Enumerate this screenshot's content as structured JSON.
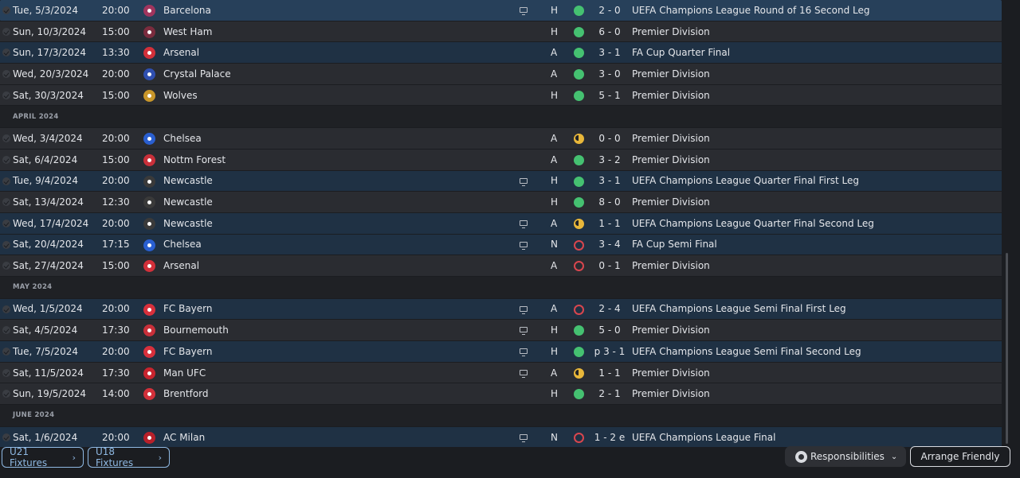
{
  "rows": [
    {
      "type": "match",
      "cls": "comp sel",
      "date": "Tue, 5/3/2024",
      "time": "20:00",
      "opponent": "Barcelona",
      "badge_color": "#a1355e",
      "badge_icon": "crest-icon",
      "tv": true,
      "venue": "H",
      "result": "w",
      "score": "2 - 0",
      "competition": "UEFA Champions League Round of 16 Second Leg"
    },
    {
      "type": "match",
      "cls": "dom",
      "date": "Sun, 10/3/2024",
      "time": "15:00",
      "opponent": "West Ham",
      "badge_color": "#7b2c3e",
      "badge_icon": "crest-icon",
      "tv": false,
      "venue": "H",
      "result": "w",
      "score": "6 - 0",
      "competition": "Premier Division"
    },
    {
      "type": "match",
      "cls": "comp",
      "date": "Sun, 17/3/2024",
      "time": "13:30",
      "opponent": "Arsenal",
      "badge_color": "#d2303a",
      "badge_icon": "crest-icon",
      "tv": false,
      "venue": "A",
      "result": "w",
      "score": "3 - 1",
      "competition": "FA Cup Quarter Final"
    },
    {
      "type": "match",
      "cls": "dom",
      "date": "Wed, 20/3/2024",
      "time": "20:00",
      "opponent": "Crystal Palace",
      "badge_color": "#2f4fb0",
      "badge_icon": "crest-icon",
      "tv": false,
      "venue": "A",
      "result": "w",
      "score": "3 - 0",
      "competition": "Premier Division"
    },
    {
      "type": "match",
      "cls": "dom",
      "date": "Sat, 30/3/2024",
      "time": "15:00",
      "opponent": "Wolves",
      "badge_color": "#c8962a",
      "badge_icon": "crest-icon",
      "tv": false,
      "venue": "H",
      "result": "w",
      "score": "5 - 1",
      "competition": "Premier Division"
    },
    {
      "type": "header",
      "label": "APRIL 2024"
    },
    {
      "type": "match",
      "cls": "dom",
      "date": "Wed, 3/4/2024",
      "time": "20:00",
      "opponent": "Chelsea",
      "badge_color": "#2a5fd0",
      "badge_icon": "crest-icon",
      "tv": false,
      "venue": "A",
      "result": "d",
      "score": "0 - 0",
      "competition": "Premier Division"
    },
    {
      "type": "match",
      "cls": "dom",
      "date": "Sat, 6/4/2024",
      "time": "15:00",
      "opponent": "Nottm Forest",
      "badge_color": "#c9303a",
      "badge_icon": "crest-icon",
      "tv": false,
      "venue": "A",
      "result": "w",
      "score": "3 - 2",
      "competition": "Premier Division"
    },
    {
      "type": "match",
      "cls": "comp",
      "date": "Tue, 9/4/2024",
      "time": "20:00",
      "opponent": "Newcastle",
      "badge_color": "#3a3a3a",
      "badge_icon": "crest-icon",
      "tv": true,
      "venue": "H",
      "result": "w",
      "score": "3 - 1",
      "competition": "UEFA Champions League Quarter Final First Leg"
    },
    {
      "type": "match",
      "cls": "dom",
      "date": "Sat, 13/4/2024",
      "time": "12:30",
      "opponent": "Newcastle",
      "badge_color": "#3a3a3a",
      "badge_icon": "crest-icon",
      "tv": false,
      "venue": "H",
      "result": "w",
      "score": "8 - 0",
      "competition": "Premier Division"
    },
    {
      "type": "match",
      "cls": "comp",
      "date": "Wed, 17/4/2024",
      "time": "20:00",
      "opponent": "Newcastle",
      "badge_color": "#3a3a3a",
      "badge_icon": "crest-icon",
      "tv": true,
      "venue": "A",
      "result": "d",
      "score": "1 - 1",
      "competition": "UEFA Champions League Quarter Final Second Leg"
    },
    {
      "type": "match",
      "cls": "comp",
      "date": "Sat, 20/4/2024",
      "time": "17:15",
      "opponent": "Chelsea",
      "badge_color": "#2a5fd0",
      "badge_icon": "crest-icon",
      "tv": true,
      "venue": "N",
      "result": "l",
      "score": "3 - 4",
      "competition": "FA Cup Semi Final"
    },
    {
      "type": "match",
      "cls": "dom",
      "date": "Sat, 27/4/2024",
      "time": "15:00",
      "opponent": "Arsenal",
      "badge_color": "#d2303a",
      "badge_icon": "crest-icon",
      "tv": false,
      "venue": "A",
      "result": "l",
      "score": "0 - 1",
      "competition": "Premier Division"
    },
    {
      "type": "header",
      "label": "MAY 2024"
    },
    {
      "type": "match",
      "cls": "comp",
      "date": "Wed, 1/5/2024",
      "time": "20:00",
      "opponent": "FC Bayern",
      "badge_color": "#d8303c",
      "badge_icon": "crest-icon",
      "tv": true,
      "venue": "A",
      "result": "l",
      "score": "2 - 4",
      "competition": "UEFA Champions League Semi Final First Leg"
    },
    {
      "type": "match",
      "cls": "dom",
      "date": "Sat, 4/5/2024",
      "time": "17:30",
      "opponent": "Bournemouth",
      "badge_color": "#c9303a",
      "badge_icon": "crest-icon",
      "tv": true,
      "venue": "H",
      "result": "w",
      "score": "5 - 0",
      "competition": "Premier Division"
    },
    {
      "type": "match",
      "cls": "comp",
      "date": "Tue, 7/5/2024",
      "time": "20:00",
      "opponent": "FC Bayern",
      "badge_color": "#d8303c",
      "badge_icon": "crest-icon",
      "tv": true,
      "venue": "H",
      "result": "w",
      "score": "p 3 - 1",
      "competition": "UEFA Champions League Semi Final Second Leg"
    },
    {
      "type": "match",
      "cls": "dom",
      "date": "Sat, 11/5/2024",
      "time": "17:30",
      "opponent": "Man UFC",
      "badge_color": "#c8242e",
      "badge_icon": "crest-icon",
      "tv": true,
      "venue": "A",
      "result": "d",
      "score": "1 - 1",
      "competition": "Premier Division"
    },
    {
      "type": "match",
      "cls": "dom",
      "date": "Sun, 19/5/2024",
      "time": "14:00",
      "opponent": "Brentford",
      "badge_color": "#d2303a",
      "badge_icon": "crest-icon",
      "tv": false,
      "venue": "H",
      "result": "w",
      "score": "2 - 1",
      "competition": "Premier Division"
    },
    {
      "type": "header",
      "label": "JUNE 2024"
    },
    {
      "type": "match",
      "cls": "comp",
      "date": "Sat, 1/6/2024",
      "time": "20:00",
      "opponent": "AC Milan",
      "badge_color": "#b8202a",
      "badge_icon": "crest-icon",
      "tv": true,
      "venue": "N",
      "result": "l",
      "score": "1 - 2 e",
      "competition": "UEFA Champions League Final"
    }
  ],
  "buttons": {
    "u21": "U21 Fixtures",
    "u18": "U18 Fixtures",
    "responsibilities": "Responsibilities",
    "arrange": "Arrange Friendly"
  }
}
